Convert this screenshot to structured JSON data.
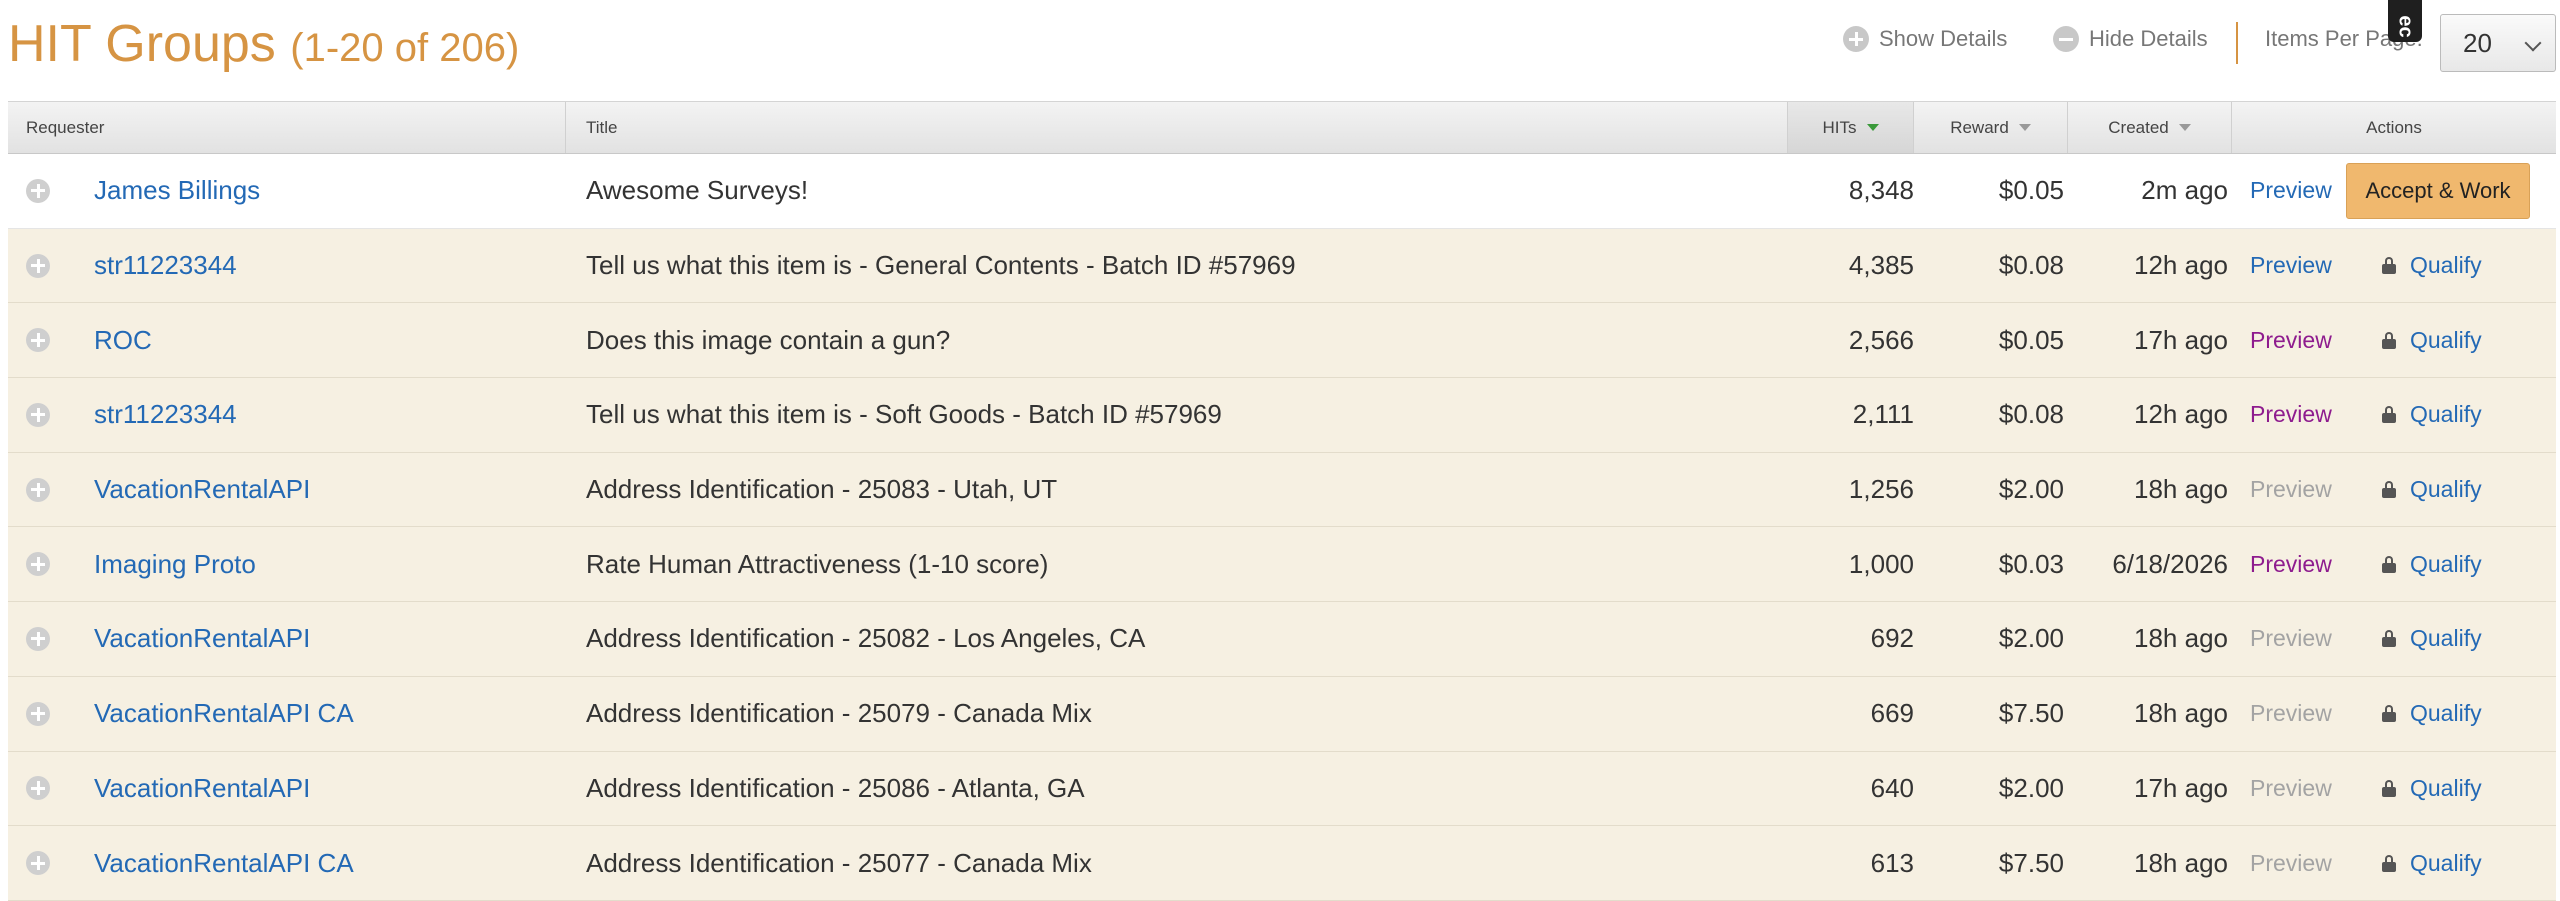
{
  "header": {
    "title": "HIT Groups",
    "count": "(1-20 of 206)",
    "show_details": "Show Details",
    "hide_details": "Hide Details",
    "items_per_page_label": "Items Per Page:",
    "items_per_page_value": "20",
    "tab_glyph": "ec"
  },
  "columns": {
    "requester": "Requester",
    "title": "Title",
    "hits": "HITs",
    "reward": "Reward",
    "created": "Created",
    "actions": "Actions"
  },
  "rows": [
    {
      "requester": "James Billings",
      "title": "Awesome Surveys!",
      "hits": "8,348",
      "reward": "$0.05",
      "created": "2m ago",
      "preview": "Preview",
      "preview_state": "blue",
      "action": "Accept & Work"
    },
    {
      "requester": "str11223344",
      "title": "Tell us what this item is - General Contents - Batch ID #57969",
      "hits": "4,385",
      "reward": "$0.08",
      "created": "12h ago",
      "preview": "Preview",
      "preview_state": "blue",
      "action": "Qualify"
    },
    {
      "requester": "ROC",
      "title": "Does this image contain a gun?",
      "hits": "2,566",
      "reward": "$0.05",
      "created": "17h ago",
      "preview": "Preview",
      "preview_state": "purple",
      "action": "Qualify"
    },
    {
      "requester": "str11223344",
      "title": "Tell us what this item is - Soft Goods - Batch ID #57969",
      "hits": "2,111",
      "reward": "$0.08",
      "created": "12h ago",
      "preview": "Preview",
      "preview_state": "purple",
      "action": "Qualify"
    },
    {
      "requester": "VacationRentalAPI",
      "title": "Address Identification - 25083 - Utah, UT",
      "hits": "1,256",
      "reward": "$2.00",
      "created": "18h ago",
      "preview": "Preview",
      "preview_state": "grey",
      "action": "Qualify"
    },
    {
      "requester": "Imaging Proto",
      "title": "Rate Human Attractiveness (1-10 score)",
      "hits": "1,000",
      "reward": "$0.03",
      "created": "6/18/2026",
      "preview": "Preview",
      "preview_state": "purple",
      "action": "Qualify"
    },
    {
      "requester": "VacationRentalAPI",
      "title": "Address Identification - 25082 - Los Angeles, CA",
      "hits": "692",
      "reward": "$2.00",
      "created": "18h ago",
      "preview": "Preview",
      "preview_state": "grey",
      "action": "Qualify"
    },
    {
      "requester": "VacationRentalAPI CA",
      "title": "Address Identification - 25079 - Canada Mix",
      "hits": "669",
      "reward": "$7.50",
      "created": "18h ago",
      "preview": "Preview",
      "preview_state": "grey",
      "action": "Qualify"
    },
    {
      "requester": "VacationRentalAPI",
      "title": "Address Identification - 25086 - Atlanta, GA",
      "hits": "640",
      "reward": "$2.00",
      "created": "17h ago",
      "preview": "Preview",
      "preview_state": "grey",
      "action": "Qualify"
    },
    {
      "requester": "VacationRentalAPI CA",
      "title": "Address Identification - 25077 - Canada Mix",
      "hits": "613",
      "reward": "$7.50",
      "created": "18h ago",
      "preview": "Preview",
      "preview_state": "grey",
      "action": "Qualify"
    }
  ],
  "colors": {
    "accent": "#d69443",
    "link": "#2369b5",
    "visited": "#8e1b8e",
    "row_bg": "#f6f0e2",
    "accept_button": "#f0b86e"
  }
}
